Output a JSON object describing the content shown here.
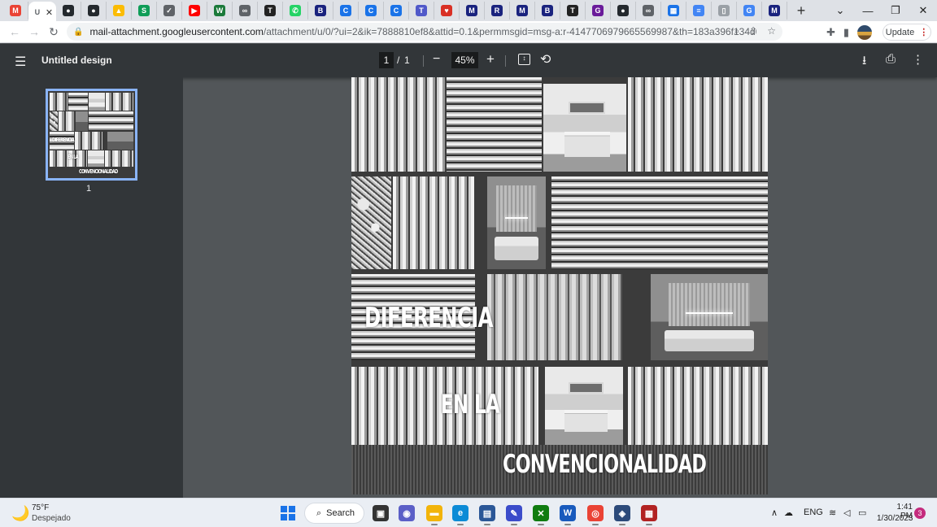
{
  "browser": {
    "tabs": [
      {
        "icon": "gmail-icon",
        "glyph": "M",
        "color": "#ea4335"
      },
      {
        "icon": "active-tab",
        "glyph": "U",
        "color": "#5f6368",
        "active": true
      },
      {
        "icon": "github-icon",
        "glyph": "●",
        "color": "#24292e"
      },
      {
        "icon": "github-icon",
        "glyph": "●",
        "color": "#24292e"
      },
      {
        "icon": "drive-icon",
        "glyph": "▲",
        "color": "#fbbc04"
      },
      {
        "icon": "sheets-icon",
        "glyph": "S",
        "color": "#0f9d58"
      },
      {
        "icon": "check-icon",
        "glyph": "✓",
        "color": "#5f6368"
      },
      {
        "icon": "youtube-icon",
        "glyph": "▶",
        "color": "#ff0000"
      },
      {
        "icon": "wa-icon",
        "glyph": "W",
        "color": "#1b7a3a"
      },
      {
        "icon": "link-icon",
        "glyph": "∞",
        "color": "#5f6368"
      },
      {
        "icon": "tag-icon",
        "glyph": "T",
        "color": "#222222"
      },
      {
        "icon": "whatsapp-icon",
        "glyph": "✆",
        "color": "#25d366"
      },
      {
        "icon": "bookmark-icon",
        "glyph": "B",
        "color": "#1a237e"
      },
      {
        "icon": "c-icon",
        "glyph": "C",
        "color": "#1a73e8"
      },
      {
        "icon": "c-icon",
        "glyph": "C",
        "color": "#1a73e8"
      },
      {
        "icon": "c-icon",
        "glyph": "C",
        "color": "#1a73e8"
      },
      {
        "icon": "teams-icon",
        "glyph": "T",
        "color": "#5059c9"
      },
      {
        "icon": "heart-icon",
        "glyph": "♥",
        "color": "#d93025"
      },
      {
        "icon": "m-icon",
        "glyph": "M",
        "color": "#1a237e"
      },
      {
        "icon": "r-icon",
        "glyph": "R",
        "color": "#1a237e"
      },
      {
        "icon": "m-icon",
        "glyph": "M",
        "color": "#1a237e"
      },
      {
        "icon": "bookmark-icon",
        "glyph": "B",
        "color": "#1a237e"
      },
      {
        "icon": "tag-icon",
        "glyph": "T",
        "color": "#222222"
      },
      {
        "icon": "g-icon",
        "glyph": "G",
        "color": "#6a1b9a"
      },
      {
        "icon": "github-icon",
        "glyph": "●",
        "color": "#24292e"
      },
      {
        "icon": "link-icon",
        "glyph": "∞",
        "color": "#5f6368"
      },
      {
        "icon": "calendar-icon",
        "glyph": "▦",
        "color": "#1a73e8"
      },
      {
        "icon": "docs-icon",
        "glyph": "≡",
        "color": "#4285f4"
      },
      {
        "icon": "file-icon",
        "glyph": "▯",
        "color": "#9aa0a6"
      },
      {
        "icon": "google-icon",
        "glyph": "G",
        "color": "#4285f4"
      },
      {
        "icon": "m-icon",
        "glyph": "M",
        "color": "#1a237e"
      }
    ],
    "new_tab": "+",
    "window": {
      "minimize": "—",
      "maximize": "❐",
      "close": "✕",
      "tab_list": "⌄"
    },
    "nav": {
      "back": "←",
      "forward": "→",
      "reload": "↻"
    },
    "url_host": "mail-attachment.googleusercontent.com",
    "url_path": "/attachment/u/0/?ui=2&ik=7888810ef8&attid=0.1&permmsgid=msg-a:r-4147706979665569987&th=183a396f134d0531&view=att&d...",
    "update_label": "Update"
  },
  "pdf": {
    "title": "Untitled design",
    "page_current": "1",
    "page_sep": "/",
    "page_total": "1",
    "zoom": "45%",
    "thumb_label": "1"
  },
  "document": {
    "line1": "DIFERENCIA",
    "line2": "EN LA",
    "line3": "CONVENCIONALIDAD"
  },
  "taskbar": {
    "temperature": "75°F",
    "condition": "Despejado",
    "search_label": "Search",
    "language": "ENG",
    "time": "1:41 PM",
    "date": "1/30/2023",
    "notifications": "3",
    "apps": [
      {
        "icon": "task-view-icon",
        "glyph": "▣",
        "color": "#333333"
      },
      {
        "icon": "chat-icon",
        "glyph": "◉",
        "color": "#5b5fc7"
      },
      {
        "icon": "file-explorer-icon",
        "glyph": "▬",
        "color": "#f2b40a"
      },
      {
        "icon": "edge-icon",
        "glyph": "e",
        "color": "#0c8bd6"
      },
      {
        "icon": "store-icon",
        "glyph": "▤",
        "color": "#2b5797"
      },
      {
        "icon": "pen-icon",
        "glyph": "✎",
        "color": "#3b4cca"
      },
      {
        "icon": "xbox-icon",
        "glyph": "✕",
        "color": "#107c10"
      },
      {
        "icon": "word-icon",
        "glyph": "W",
        "color": "#185abd"
      },
      {
        "icon": "chrome-icon",
        "glyph": "◎",
        "color": "#ea4335"
      },
      {
        "icon": "vpn-icon",
        "glyph": "◈",
        "color": "#2c4a7a"
      },
      {
        "icon": "photos-icon",
        "glyph": "▦",
        "color": "#b22222"
      }
    ]
  }
}
